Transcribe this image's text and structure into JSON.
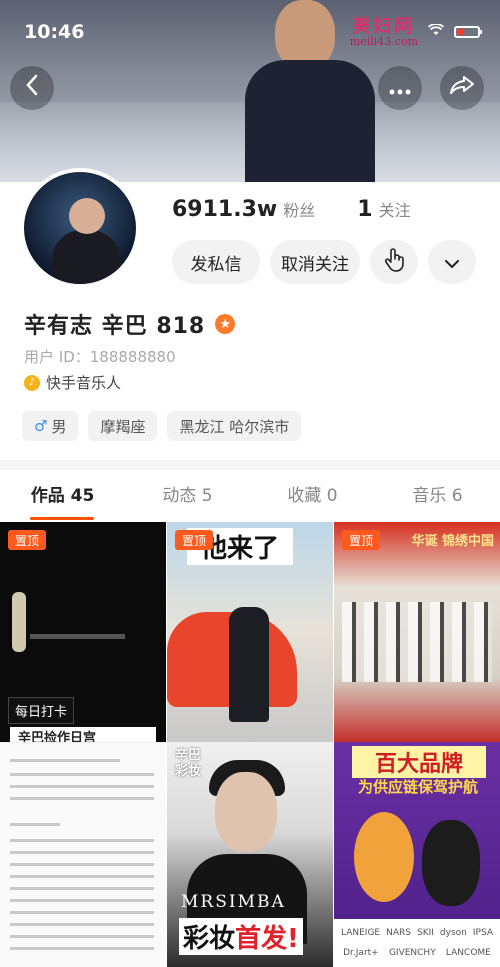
{
  "status_bar": {
    "time": "10:46",
    "watermark_text": "美妇网",
    "watermark_url": "meili43.com"
  },
  "profile": {
    "followers_count": "6911.3w",
    "followers_label": "粉丝",
    "following_count": "1",
    "following_label": "关注",
    "message_button": "发私信",
    "unfollow_button": "取消关注",
    "name": "辛有志 辛巴 818",
    "user_id": "用户 ID：188888880",
    "tagline": "快手音乐人",
    "chips": {
      "gender": "男",
      "gender_symbol": "♂",
      "zodiac": "摩羯座",
      "location": "黑龙江 哈尔滨市"
    }
  },
  "tabs": [
    {
      "label": "作品 45"
    },
    {
      "label": "动态 5"
    },
    {
      "label": "收藏 0"
    },
    {
      "label": "音乐 6"
    }
  ],
  "grid": {
    "pin_label": "置顶",
    "cell1": {
      "banner": "每日打卡",
      "strip": "辛巴捡作日宫"
    },
    "cell2": {
      "headline": "他来了"
    },
    "cell3": {
      "slogan": "华诞 锦绣中国"
    },
    "cell5": {
      "vertical_text": "辛巴彩妆",
      "brand": "MRSIMBA",
      "big_left": "彩妆",
      "big_right": "首发!"
    },
    "cell6": {
      "headline": "百大品牌",
      "subline": "为供应链保驾护航",
      "brands": [
        "LANEIGE",
        "NARS",
        "SKII",
        "dyson",
        "IPSA",
        "Dr.Jart+",
        "GIVENCHY",
        "LANCOME"
      ]
    }
  }
}
